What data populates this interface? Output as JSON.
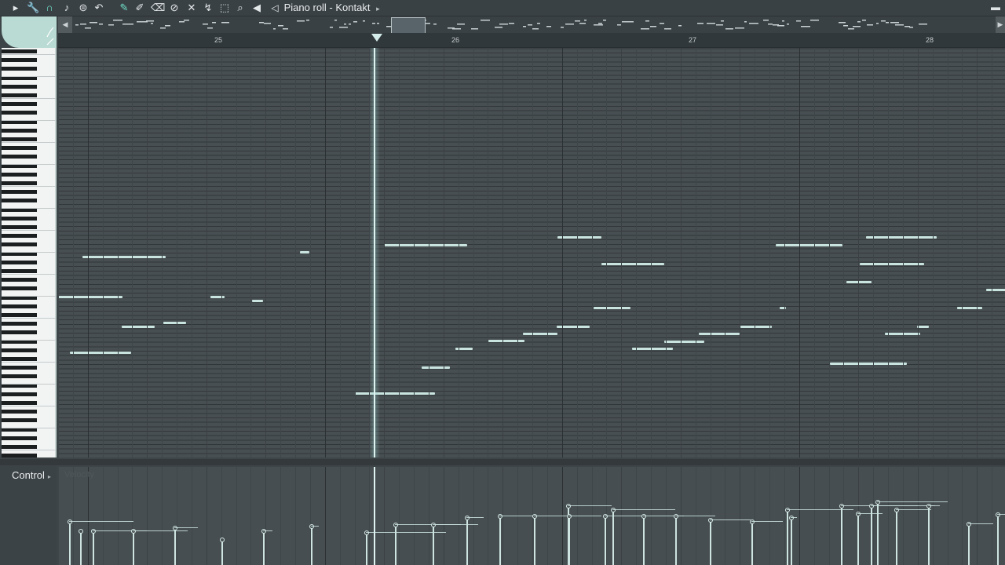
{
  "window": {
    "title": "Piano roll - Kontakt"
  },
  "toolbar": {
    "icons": [
      {
        "name": "menu-arrow-icon",
        "glyph": "▸"
      },
      {
        "name": "wrench-icon",
        "glyph": "🔧"
      },
      {
        "name": "magnet-icon",
        "glyph": "∩",
        "active": true
      },
      {
        "name": "note-icon",
        "glyph": "♪"
      },
      {
        "name": "stamp-icon",
        "glyph": "⊜"
      },
      {
        "name": "undo-icon",
        "glyph": "↶"
      },
      {
        "name": "pencil-icon",
        "glyph": "✎",
        "active": true
      },
      {
        "name": "paint-icon",
        "glyph": "✐"
      },
      {
        "name": "erase-icon",
        "glyph": "⌫"
      },
      {
        "name": "delete-icon",
        "glyph": "⊘"
      },
      {
        "name": "mute-icon",
        "glyph": "✕"
      },
      {
        "name": "slice-icon",
        "glyph": "↯"
      },
      {
        "name": "select-icon",
        "glyph": "⬚"
      },
      {
        "name": "zoom-icon",
        "glyph": "⌕"
      },
      {
        "name": "playback-icon",
        "glyph": "◀"
      }
    ],
    "speaker_glyph": "◁",
    "title_arrow": "▸",
    "window_control": "▬"
  },
  "timeline": {
    "bars": [
      "25",
      "26",
      "27",
      "28"
    ]
  },
  "control": {
    "label": "Control",
    "arrow": "▸",
    "target": "Velocity"
  },
  "colors": {
    "accent": "#6fe0c8",
    "note": "#c9e3df",
    "grid": "#484f52"
  }
}
